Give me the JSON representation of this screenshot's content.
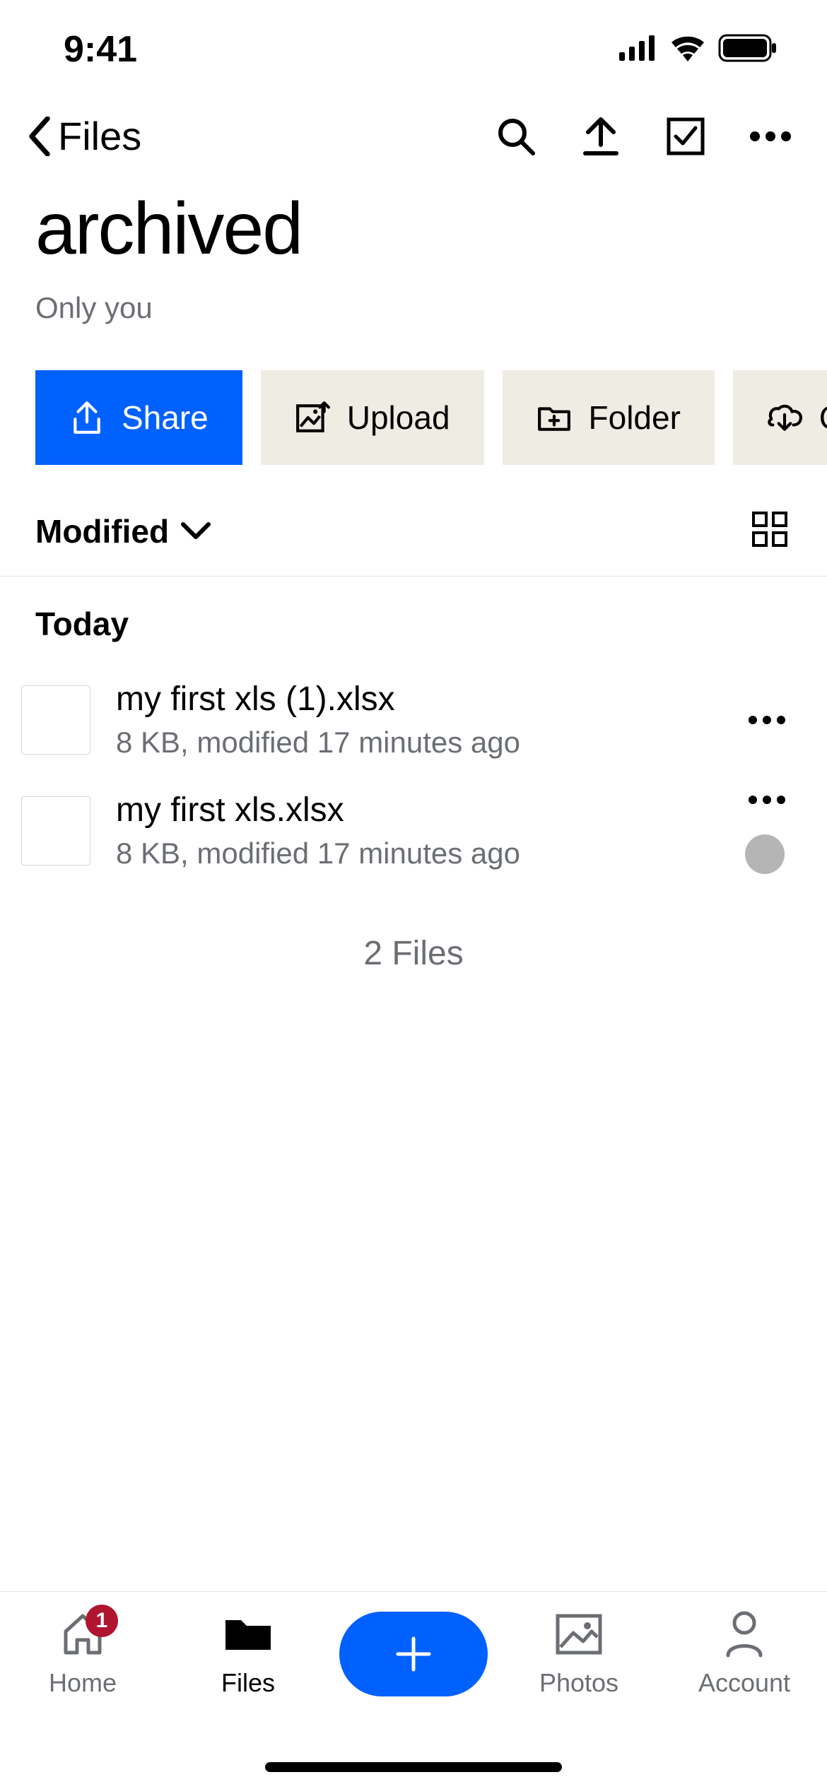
{
  "status": {
    "time": "9:41"
  },
  "nav": {
    "back_label": "Files"
  },
  "header": {
    "title": "archived",
    "subtitle": "Only you"
  },
  "chips": {
    "share": "Share",
    "upload": "Upload",
    "folder": "Folder",
    "offline": "Offline"
  },
  "sort": {
    "label": "Modified"
  },
  "list": {
    "section": "Today",
    "items": [
      {
        "name": "my first xls (1).xlsx",
        "meta": "8 KB, modified 17 minutes ago"
      },
      {
        "name": "my first xls.xlsx",
        "meta": "8 KB, modified 17 minutes ago"
      }
    ],
    "summary": "2 Files"
  },
  "tabs": {
    "home": "Home",
    "files": "Files",
    "photos": "Photos",
    "account": "Account",
    "home_badge": "1"
  }
}
